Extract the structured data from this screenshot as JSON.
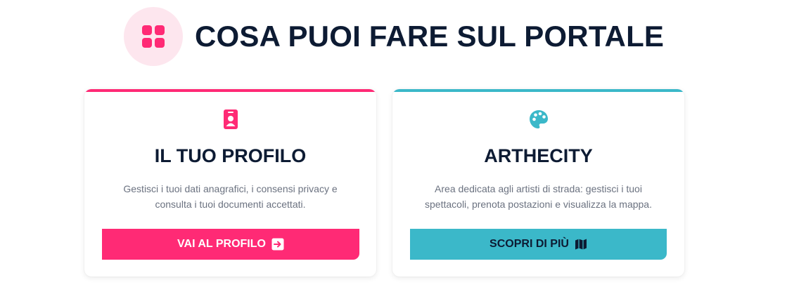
{
  "header": {
    "title": "COSA PUOI FARE SUL PORTALE",
    "icon": "grid-icon"
  },
  "colors": {
    "pink": "#ff2a75",
    "teal": "#3bb8c9",
    "navy": "#0d1b33",
    "badge_bg": "#fde6ee"
  },
  "cards": [
    {
      "icon": "id-badge-icon",
      "title": "IL TUO PROFILO",
      "description": "Gestisci i tuoi dati anagrafici, i consensi privacy e consulta i tuoi documenti accettati.",
      "button_label": "VAI AL PROFILO",
      "button_icon": "arrow-right-square-icon"
    },
    {
      "icon": "palette-icon",
      "title": "ARTHECITY",
      "description": "Area dedicata agli artisti di strada: gestisci i tuoi spettacoli, prenota postazioni e visualizza la mappa.",
      "button_label": "SCOPRI DI PIÙ",
      "button_icon": "map-icon"
    }
  ]
}
